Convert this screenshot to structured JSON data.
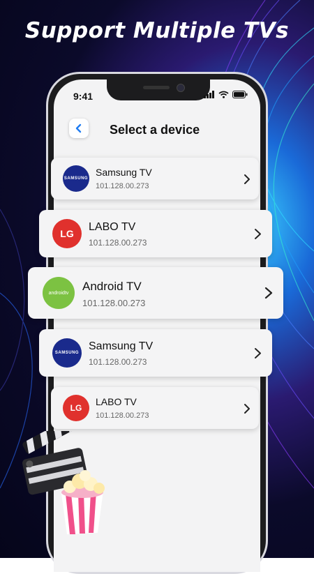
{
  "headline": "Support Multiple TVs",
  "status_bar": {
    "time": "9:41"
  },
  "header": {
    "title": "Select a device"
  },
  "devices": [
    {
      "name": "Samsung TV",
      "ip": "101.128.00.273",
      "logo_text": "SAMSUNG",
      "brand": "samsung"
    },
    {
      "name": "LABO TV",
      "ip": "101.128.00.273",
      "logo_text": "LG",
      "brand": "lg"
    },
    {
      "name": "Android TV",
      "ip": "101.128.00.273",
      "logo_text": "androidtv",
      "brand": "android"
    },
    {
      "name": "Samsung TV",
      "ip": "101.128.00.273",
      "logo_text": "SAMSUNG",
      "brand": "samsung"
    },
    {
      "name": "LABO TV",
      "ip": "101.128.00.273",
      "logo_text": "LG",
      "brand": "lg"
    }
  ],
  "colors": {
    "samsung": "#1a2a8c",
    "lg": "#e0312d",
    "android": "#7cc242",
    "accent": "#1e7cf2"
  }
}
